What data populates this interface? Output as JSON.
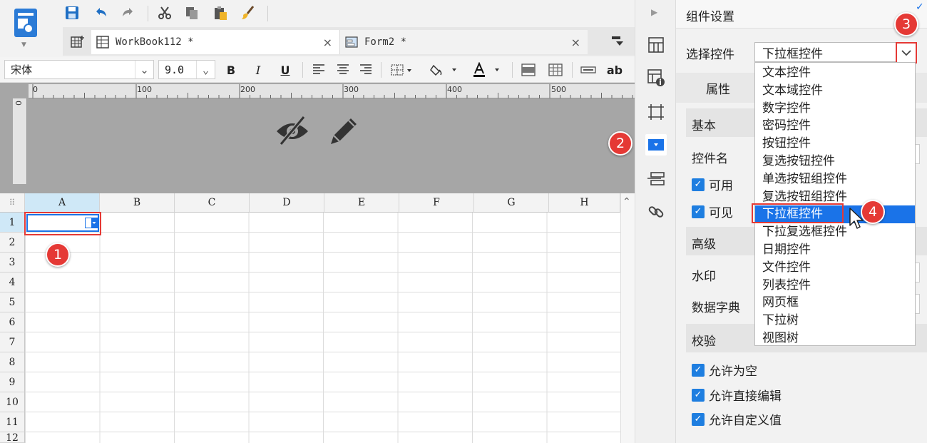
{
  "tabs": [
    {
      "label": "WorkBook112 *",
      "close": "×"
    },
    {
      "label": "Form2 *",
      "close": "×"
    }
  ],
  "format": {
    "font_name": "宋体",
    "font_size": "9.0",
    "bold": "B",
    "italic": "I",
    "underline": "U",
    "text_label": "ab"
  },
  "ruler": {
    "marks": [
      "0",
      "100",
      "200",
      "300",
      "400",
      "500"
    ],
    "v_mark": "0"
  },
  "grid": {
    "columns": [
      "A",
      "B",
      "C",
      "D",
      "E",
      "F",
      "G",
      "H"
    ],
    "rows": [
      "1",
      "2",
      "3",
      "4",
      "5",
      "6",
      "7",
      "8",
      "9",
      "10",
      "11",
      "12"
    ]
  },
  "panel": {
    "title": "组件设置",
    "select_label": "选择控件",
    "select_value": "下拉框控件",
    "tab_label": "属性",
    "section_basic": "基本",
    "field_name": "控件名",
    "chk_enabled": "可用",
    "chk_visible": "可见",
    "section_advanced": "高级",
    "field_watermark": "水印",
    "field_dict": "数据字典",
    "section_validate": "校验",
    "chk_allow_empty": "允许为空",
    "chk_allow_edit": "允许直接编辑",
    "chk_allow_custom": "允许自定义值"
  },
  "dropdown_options": [
    "文本控件",
    "文本域控件",
    "数字控件",
    "密码控件",
    "按钮控件",
    "复选按钮控件",
    "单选按钮组控件",
    "复选按钮组控件",
    "下拉框控件",
    "下拉复选框控件",
    "日期控件",
    "文件控件",
    "列表控件",
    "网页框",
    "下拉树",
    "视图树"
  ],
  "selected_option_index": 8,
  "markers": [
    "1",
    "2",
    "3",
    "4"
  ],
  "colors": {
    "accent": "#1a73e8",
    "marker": "#e53935",
    "checkbox": "#1e7ee0"
  }
}
